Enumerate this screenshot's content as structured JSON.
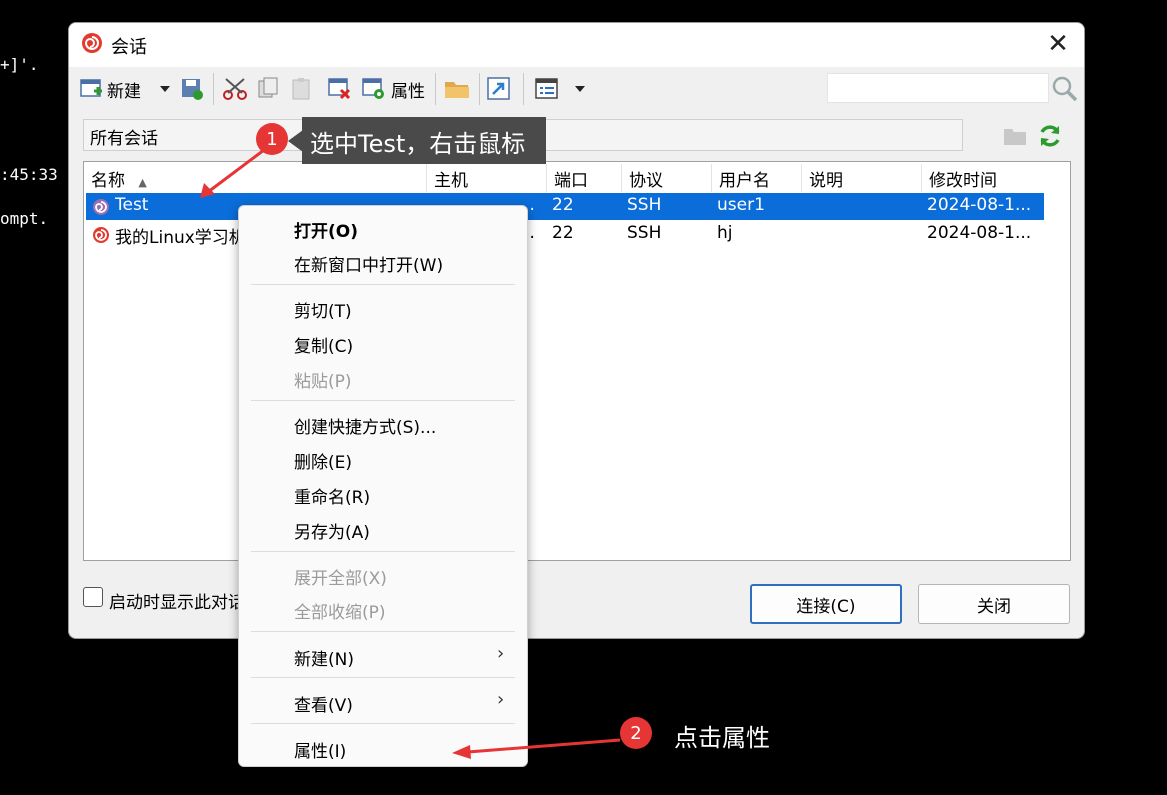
{
  "terminal": {
    "line1": "+]'.",
    "line2": ":45:33",
    "line3": "ompt."
  },
  "dialog": {
    "title": "会话",
    "close_glyph": "✕",
    "toolbar": {
      "new_label": "新建",
      "properties_label": "属性"
    },
    "folder_path": "所有会话",
    "columns": [
      "名称",
      "主机",
      "端口",
      "协议",
      "用户名",
      "说明",
      "修改时间"
    ],
    "sort_glyph": "▲",
    "rows": [
      {
        "name": "Test",
        "host": "…",
        "port": "22",
        "protocol": "SSH",
        "user": "user1",
        "desc": "",
        "modified": "2024-08-1..."
      },
      {
        "name": "我的Linux学习机",
        "host": "…",
        "port": "22",
        "protocol": "SSH",
        "user": "hj",
        "desc": "",
        "modified": "2024-08-1..."
      }
    ],
    "startup_checkbox_label": "启动时显示此对话框",
    "connect_label": "连接(C)",
    "close_label": "关闭"
  },
  "context_menu": {
    "open": "打开(O)",
    "open_new_window": "在新窗口中打开(W)",
    "cut": "剪切(T)",
    "copy": "复制(C)",
    "paste": "粘贴(P)",
    "create_shortcut": "创建快捷方式(S)...",
    "delete": "删除(E)",
    "rename": "重命名(R)",
    "save_as": "另存为(A)",
    "expand_all": "展开全部(X)",
    "collapse_all": "全部收缩(P)",
    "new": "新建(N)",
    "view": "查看(V)",
    "properties": "属性(I)",
    "submenu_glyph": "›"
  },
  "annotations": {
    "step1_number": "1",
    "step1_text": "选中Test，右击鼠标",
    "step2_number": "2",
    "step2_text": "点击属性"
  },
  "colors": {
    "selection": "#0a6dd9",
    "annotation_red": "#e53535",
    "callout_bg": "#4a4a4a"
  }
}
